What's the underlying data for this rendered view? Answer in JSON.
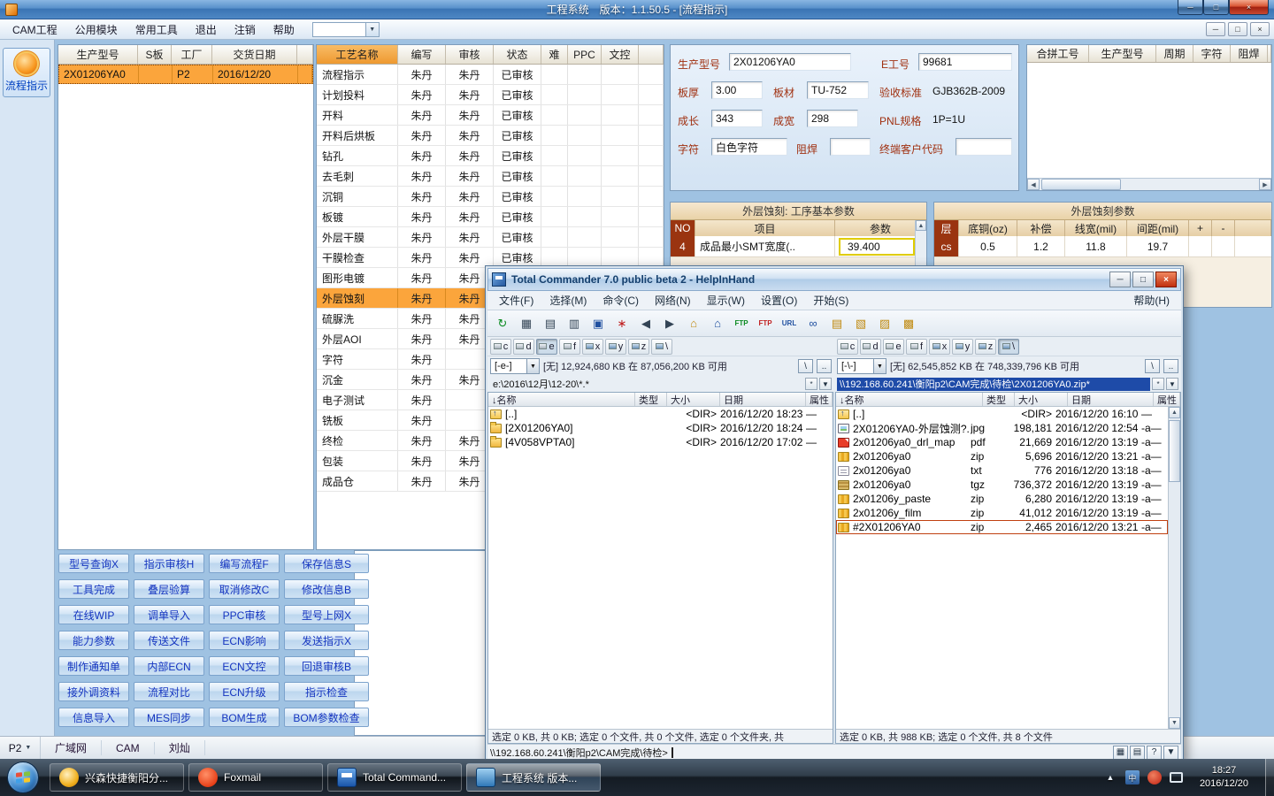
{
  "icons": {
    "dropdown": "▼",
    "up": "▲",
    "down": "▼",
    "left": "◀",
    "right": "▶",
    "min": "─",
    "max": "□",
    "close": "×"
  },
  "app": {
    "title": "工程系统　版本：1.1.50.5 - [流程指示]",
    "menu_items": [
      "CAM工程",
      "公用模块",
      "常用工具",
      "退出",
      "注销",
      "帮助"
    ],
    "sidebar_flow_label": "流程指示"
  },
  "order_table": {
    "headers": [
      "生产型号",
      "S板",
      "工厂",
      "交货日期"
    ],
    "row": {
      "model": "2X01206YA0",
      "sboard": "",
      "factory": "P2",
      "date": "2016/12/20"
    }
  },
  "process_table": {
    "headers": [
      "工艺名称",
      "编写",
      "审核",
      "状态",
      "难",
      "PPC",
      "文控"
    ],
    "rows": [
      {
        "name": "流程指示",
        "w": "朱丹",
        "r": "朱丹",
        "s": "已审核"
      },
      {
        "name": "计划投料",
        "w": "朱丹",
        "r": "朱丹",
        "s": "已审核"
      },
      {
        "name": "开料",
        "w": "朱丹",
        "r": "朱丹",
        "s": "已审核"
      },
      {
        "name": "开料后烘板",
        "w": "朱丹",
        "r": "朱丹",
        "s": "已审核"
      },
      {
        "name": "钻孔",
        "w": "朱丹",
        "r": "朱丹",
        "s": "已审核"
      },
      {
        "name": "去毛刺",
        "w": "朱丹",
        "r": "朱丹",
        "s": "已审核"
      },
      {
        "name": "沉铜",
        "w": "朱丹",
        "r": "朱丹",
        "s": "已审核"
      },
      {
        "name": "板镀",
        "w": "朱丹",
        "r": "朱丹",
        "s": "已审核"
      },
      {
        "name": "外层干膜",
        "w": "朱丹",
        "r": "朱丹",
        "s": "已审核"
      },
      {
        "name": "干膜检查",
        "w": "朱丹",
        "r": "朱丹",
        "s": "已审核"
      },
      {
        "name": "图形电镀",
        "w": "朱丹",
        "r": "朱丹",
        "s": ""
      },
      {
        "name": "外层蚀刻",
        "w": "朱丹",
        "r": "朱丹",
        "s": "",
        "cls": "sel"
      },
      {
        "name": "硫脲洗",
        "w": "朱丹",
        "r": "朱丹",
        "s": ""
      },
      {
        "name": "外层AOI",
        "w": "朱丹",
        "r": "朱丹",
        "s": ""
      },
      {
        "name": "字符",
        "w": "朱丹",
        "r": "",
        "s": ""
      },
      {
        "name": "沉金",
        "w": "朱丹",
        "r": "朱丹",
        "s": ""
      },
      {
        "name": "电子测试",
        "w": "朱丹",
        "r": "",
        "s": ""
      },
      {
        "name": "铣板",
        "w": "朱丹",
        "r": "",
        "s": ""
      },
      {
        "name": "终检",
        "w": "朱丹",
        "r": "朱丹",
        "s": ""
      },
      {
        "name": "包装",
        "w": "朱丹",
        "r": "朱丹",
        "s": ""
      },
      {
        "name": "成品仓",
        "w": "朱丹",
        "r": "朱丹",
        "s": ""
      }
    ]
  },
  "info": {
    "model_label": "生产型号",
    "model": "2X01206YA0",
    "eno_label": "E工号",
    "eno": "99681",
    "thickness_label": "板厚",
    "thickness": "3.00",
    "material_label": "板材",
    "material": "TU-752",
    "standard_label": "验收标准",
    "standard": "GJB362B-2009",
    "length_label": "成长",
    "length": "343",
    "width_label": "成宽",
    "width": "298",
    "pnl_label": "PNL规格",
    "pnl": "1P=1U",
    "silk_label": "字符",
    "silk": "白色字符",
    "mask_label": "阻焊",
    "mask": "",
    "client_label": "终端客户代码",
    "client": ""
  },
  "merge_table": {
    "headers": [
      "合拼工号",
      "生产型号",
      "周期",
      "字符",
      "阻焊"
    ]
  },
  "etch_basic": {
    "title": "外层蚀刻: 工序基本参数",
    "headers": [
      "NO",
      "项目",
      "参数"
    ],
    "row": {
      "no": "4",
      "item": "成品最小SMT宽度(..",
      "value": "39.400"
    }
  },
  "etch_params": {
    "title": "外层蚀刻参数",
    "headers": [
      "层",
      "底铜(oz)",
      "补偿",
      "线宽(mil)",
      "间距(mil)",
      "+",
      "-"
    ],
    "row": {
      "layer": "cs",
      "copper": "0.5",
      "comp": "1.2",
      "line": "11.8",
      "gap": "19.7"
    }
  },
  "action_buttons": [
    "型号查询X",
    "指示审核H",
    "编写流程F",
    "保存信息S",
    "工具完成",
    "叠层验算",
    "取消修改C",
    "修改信息B",
    "在线WIP",
    "调单导入",
    "PPC审核",
    "型号上网X",
    "能力参数",
    "传送文件",
    "ECN影响",
    "发送指示X",
    "制作通知单",
    "内部ECN",
    "ECN文控",
    "回退审核B",
    "接外调资料",
    "流程对比",
    "ECN升级",
    "指示检查",
    "信息导入",
    "MES同步",
    "BOM生成",
    "BOM参数检查"
  ],
  "statusbar": {
    "left": "P2",
    "items": [
      "广域网",
      "CAM",
      "刘灿"
    ]
  },
  "tc": {
    "title": "Total Commander 7.0 public beta 2 - HelpInHand",
    "menu": [
      "文件(F)",
      "选择(M)",
      "命令(C)",
      "网络(N)",
      "显示(W)",
      "设置(O)",
      "开始(S)"
    ],
    "help": "帮助(H)",
    "toolbar": [
      {
        "g": "↻",
        "cls": "tg"
      },
      {
        "g": "▦"
      },
      {
        "g": "▤"
      },
      {
        "g": "▥"
      },
      {
        "g": "▣",
        "cls": "tb"
      },
      {
        "g": "∗",
        "cls": "tr"
      },
      {
        "g": "◀"
      },
      {
        "g": "▶"
      },
      {
        "g": "⌂",
        "cls": "ty"
      },
      {
        "g": "⌂",
        "cls": "tb"
      },
      {
        "g": "FTP",
        "cls": "tt tg"
      },
      {
        "g": "FTP",
        "cls": "tt tr"
      },
      {
        "g": "URL",
        "cls": "tt tb"
      },
      {
        "g": "∞",
        "cls": "tb"
      },
      {
        "g": "▤",
        "cls": "ty"
      },
      {
        "g": "▧",
        "cls": "ty"
      },
      {
        "g": "▨",
        "cls": "ty"
      },
      {
        "g": "▩",
        "cls": "ty"
      }
    ],
    "drives_left": [
      {
        "l": "c"
      },
      {
        "l": "d"
      },
      {
        "l": "e",
        "cls": "on"
      },
      {
        "l": "f"
      },
      {
        "l": "x",
        "cls": "net"
      },
      {
        "l": "y",
        "cls": "net"
      },
      {
        "l": "z",
        "cls": "net"
      },
      {
        "l": "\\",
        "cls": "net"
      }
    ],
    "drives_right": [
      {
        "l": "c"
      },
      {
        "l": "d"
      },
      {
        "l": "e"
      },
      {
        "l": "f"
      },
      {
        "l": "x",
        "cls": "net"
      },
      {
        "l": "y",
        "cls": "net"
      },
      {
        "l": "z",
        "cls": "net"
      },
      {
        "l": "\\",
        "cls": "net on"
      }
    ],
    "root_btn": "\\",
    "parent_btn": "..",
    "star_btn": "*",
    "columns": [
      "↓名称",
      "类型",
      "大小",
      "日期",
      "属性"
    ],
    "left": {
      "drive": "[-e-]",
      "free": "[无] 12,924,680 KB 在 87,056,200 KB 可用",
      "path": "e:\\2016\\12月\\12-20\\*.*",
      "rows": [
        {
          "name": "[..]",
          "type": "",
          "size": "<DIR>",
          "date": "2016/12/20 18:23",
          "attr": "—",
          "cls": "ic-up"
        },
        {
          "name": "[2X01206YA0]",
          "type": "",
          "size": "<DIR>",
          "date": "2016/12/20 18:24",
          "attr": "—",
          "cls": "ic-folder"
        },
        {
          "name": "[4V058VPTA0]",
          "type": "",
          "size": "<DIR>",
          "date": "2016/12/20 17:02",
          "attr": "—",
          "cls": "ic-folder"
        }
      ],
      "status": "选定 0 KB, 共 0 KB; 选定 0 个文件, 共 0 个文件, 选定 0 个文件夹, 共 "
    },
    "right": {
      "drive": "[-\\-]",
      "free": "[无] 62,545,852 KB 在 748,339,796 KB 可用",
      "path": "\\\\192.168.60.241\\衡阳p2\\CAM完成\\待检\\2X01206YA0.zip*",
      "rows": [
        {
          "name": "[..]",
          "type": "",
          "size": "<DIR>",
          "date": "2016/12/20 16:10",
          "attr": "—",
          "cls": "ic-up"
        },
        {
          "name": "2X01206YA0-外层蚀测?.",
          "type": "jpg",
          "size": "198,181",
          "date": "2016/12/20 12:54",
          "attr": "-a—",
          "cls": "ic-jpg"
        },
        {
          "name": "2x01206ya0_drl_map",
          "type": "pdf",
          "size": "21,669",
          "date": "2016/12/20 13:19",
          "attr": "-a—",
          "cls": "ic-pdf"
        },
        {
          "name": "2x01206ya0",
          "type": "zip",
          "size": "5,696",
          "date": "2016/12/20 13:21",
          "attr": "-a—",
          "cls": "ic-zip"
        },
        {
          "name": "2x01206ya0",
          "type": "txt",
          "size": "776",
          "date": "2016/12/20 13:18",
          "attr": "-a—",
          "cls": "ic-txt"
        },
        {
          "name": "2x01206ya0",
          "type": "tgz",
          "size": "736,372",
          "date": "2016/12/20 13:19",
          "attr": "-a—",
          "cls": "ic-tgz"
        },
        {
          "name": "2x01206y_paste",
          "type": "zip",
          "size": "6,280",
          "date": "2016/12/20 13:19",
          "attr": "-a—",
          "cls": "ic-zip"
        },
        {
          "name": "2x01206y_film",
          "type": "zip",
          "size": "41,012",
          "date": "2016/12/20 13:19",
          "attr": "-a—",
          "cls": "ic-zip"
        },
        {
          "name": "#2X01206YA0",
          "type": "zip",
          "size": "2,465",
          "date": "2016/12/20 13:21",
          "attr": "-a—",
          "cls": "ic-zip cur"
        }
      ],
      "status": "选定 0 KB, 共 988 KB; 选定 0 个文件, 共 8 个文件"
    },
    "cmd_btns": [
      {
        "g": "▦"
      },
      {
        "g": "▤"
      },
      {
        "g": "?"
      }
    ],
    "cmdline": "\\\\192.168.60.241\\衡阳p2\\CAM完成\\待检>"
  },
  "taskbar": {
    "buttons": [
      {
        "label": "兴森快捷衡阳分...",
        "cls": "ic-xs"
      },
      {
        "label": "Foxmail",
        "cls": "ic-fox"
      },
      {
        "label": "Total Command...",
        "cls": "ic-tc"
      },
      {
        "label": "工程系统 版本...",
        "cls": "ic-eng active"
      }
    ],
    "ime": "中",
    "clock": {
      "time": "18:27",
      "date": "2016/12/20"
    }
  }
}
